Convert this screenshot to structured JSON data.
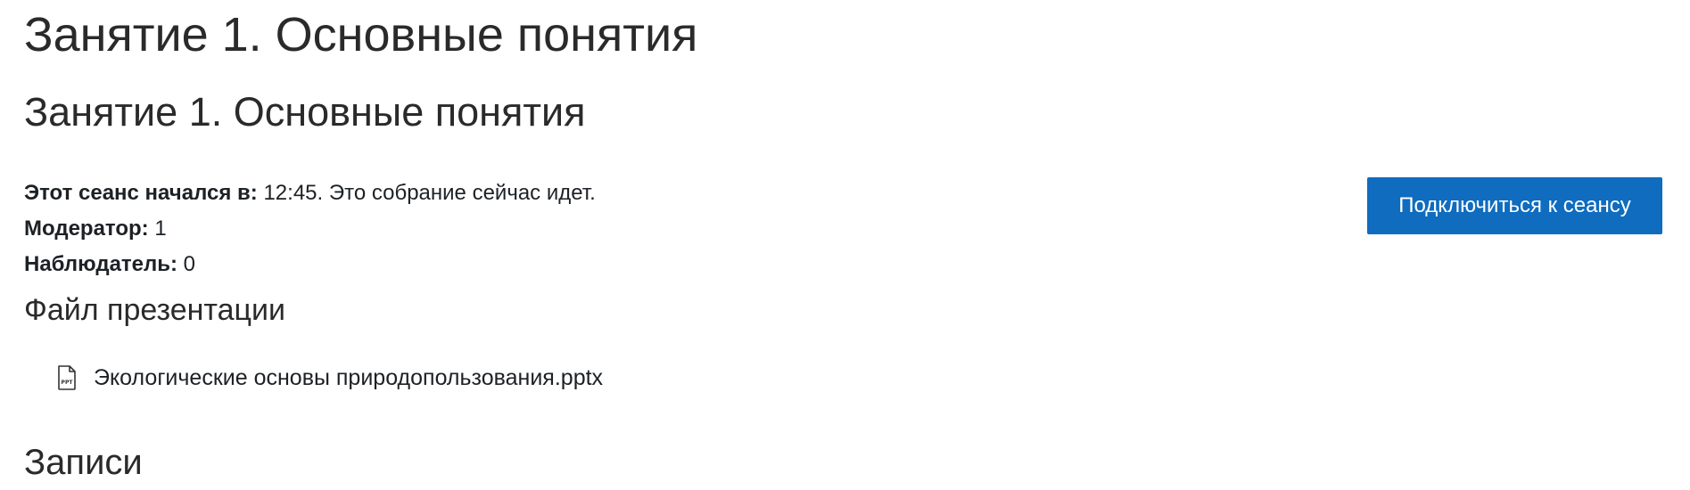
{
  "page": {
    "title": "Занятие 1. Основные понятия"
  },
  "activity": {
    "title": "Занятие 1. Основные понятия"
  },
  "session": {
    "started_label": "Этот сеанс начался в:",
    "started_value": " 12:45. Это собрание сейчас идет.",
    "moderator_label": "Модератор:",
    "moderator_value": " 1",
    "viewer_label": "Наблюдатель:",
    "viewer_value": " 0",
    "join_button_label": "Подключиться к сеансу"
  },
  "presentation": {
    "heading": "Файл презентации",
    "file_icon": "pptx-file-icon",
    "file_icon_text": "PPT",
    "file_name": "Экологические основы природопользования.pptx"
  },
  "recordings": {
    "heading": "Записи"
  },
  "colors": {
    "accent": "#0f6cbf",
    "text": "#1d2125"
  }
}
